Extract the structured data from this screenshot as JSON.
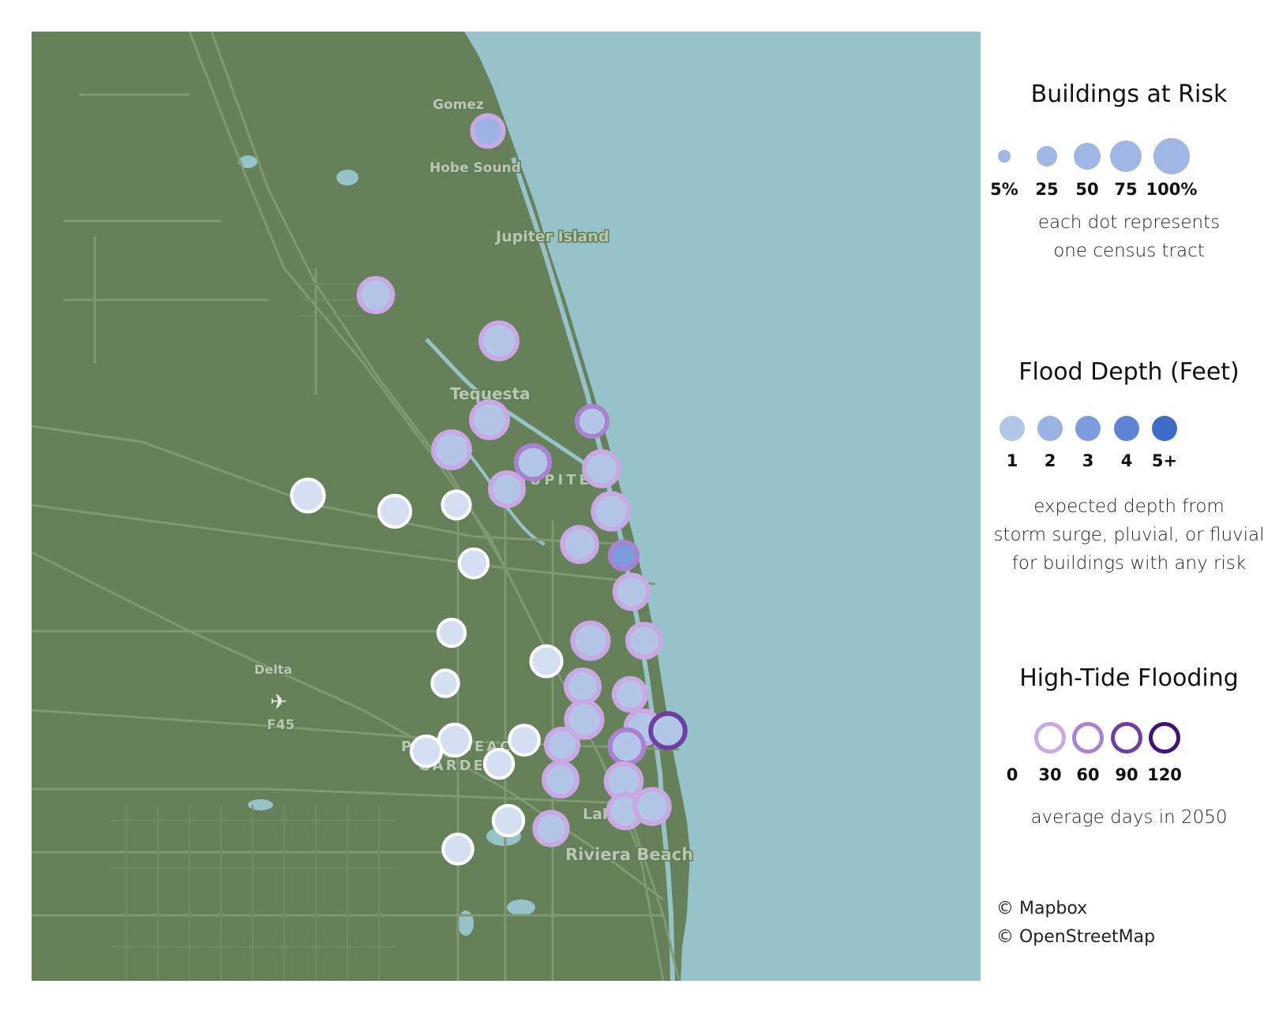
{
  "map": {
    "place_labels": [
      "Gomez",
      "Hobe Sound",
      "Jupiter Island",
      "Tequesta",
      "JUPITER",
      "Delta",
      "F45",
      "PALM BEACH",
      "GARDENS",
      "Lake Park",
      "Riviera Beach"
    ],
    "airport_icon": "airplane-icon",
    "colors": {
      "land": "#66805a",
      "water": "#96c3c9",
      "roads": "#7f9a73",
      "bubble_fill_1ft": "#b4c6e8",
      "bubble_fill_3ft": "#7b9ee0",
      "ring_none": "#ffffff",
      "ring_30": "#c9a8e4",
      "ring_60": "#a982d0",
      "ring_90": "#7b4ea8"
    },
    "tracts": [
      {
        "id": "t01",
        "risk_pct": 42,
        "depth_ft": 2,
        "tide_days": 30
      },
      {
        "id": "t02",
        "risk_pct": 52,
        "depth_ft": 1,
        "tide_days": 30
      },
      {
        "id": "t03",
        "risk_pct": 62,
        "depth_ft": 1,
        "tide_days": 30
      },
      {
        "id": "t04",
        "risk_pct": 62,
        "depth_ft": 1,
        "tide_days": 30
      },
      {
        "id": "t05",
        "risk_pct": 62,
        "depth_ft": 1,
        "tide_days": 30
      },
      {
        "id": "t06",
        "risk_pct": 40,
        "depth_ft": 1,
        "tide_days": 60
      },
      {
        "id": "t07",
        "risk_pct": 52,
        "depth_ft": 1,
        "tide_days": 60
      },
      {
        "id": "t08",
        "risk_pct": 55,
        "depth_ft": 1,
        "tide_days": 30
      },
      {
        "id": "t09",
        "risk_pct": 50,
        "depth_ft": 1,
        "tide_days": 30
      },
      {
        "id": "t10",
        "risk_pct": 60,
        "depth_ft": 1,
        "tide_days": 30
      },
      {
        "id": "t11",
        "risk_pct": 55,
        "depth_ft": 1,
        "tide_days": 30
      },
      {
        "id": "t12",
        "risk_pct": 30,
        "depth_ft": 3,
        "tide_days": 60
      },
      {
        "id": "t13",
        "risk_pct": 52,
        "depth_ft": 1,
        "tide_days": 30
      },
      {
        "id": "t14",
        "risk_pct": 60,
        "depth_ft": 1,
        "tide_days": 30
      },
      {
        "id": "t15",
        "risk_pct": 50,
        "depth_ft": 1,
        "tide_days": 30
      },
      {
        "id": "t16",
        "risk_pct": 50,
        "depth_ft": 1,
        "tide_days": 30
      },
      {
        "id": "t17",
        "risk_pct": 45,
        "depth_ft": 1,
        "tide_days": 30
      },
      {
        "id": "t18",
        "risk_pct": 60,
        "depth_ft": 1,
        "tide_days": 30
      },
      {
        "id": "t19",
        "risk_pct": 52,
        "depth_ft": 1,
        "tide_days": 30
      },
      {
        "id": "t20",
        "risk_pct": 52,
        "depth_ft": 1,
        "tide_days": 60
      },
      {
        "id": "t21",
        "risk_pct": 55,
        "depth_ft": 1,
        "tide_days": 90
      },
      {
        "id": "t22",
        "risk_pct": 45,
        "depth_ft": 1,
        "tide_days": 30
      },
      {
        "id": "t23",
        "risk_pct": 50,
        "depth_ft": 1,
        "tide_days": 30
      },
      {
        "id": "t24",
        "risk_pct": 58,
        "depth_ft": 1,
        "tide_days": 30
      },
      {
        "id": "t25",
        "risk_pct": 52,
        "depth_ft": 1,
        "tide_days": 30
      },
      {
        "id": "t26",
        "risk_pct": 55,
        "depth_ft": 1,
        "tide_days": 30
      },
      {
        "id": "t27",
        "risk_pct": 48,
        "depth_ft": 1,
        "tide_days": 30
      },
      {
        "id": "t28",
        "risk_pct": 48,
        "depth_ft": 1,
        "tide_days": 0
      },
      {
        "id": "t29",
        "risk_pct": 45,
        "depth_ft": 1,
        "tide_days": 0
      },
      {
        "id": "t30",
        "risk_pct": 32,
        "depth_ft": 1,
        "tide_days": 0
      },
      {
        "id": "t31",
        "risk_pct": 35,
        "depth_ft": 1,
        "tide_days": 0
      },
      {
        "id": "t32",
        "risk_pct": 30,
        "depth_ft": 1,
        "tide_days": 0
      },
      {
        "id": "t33",
        "risk_pct": 42,
        "depth_ft": 1,
        "tide_days": 0
      },
      {
        "id": "t34",
        "risk_pct": 28,
        "depth_ft": 1,
        "tide_days": 0
      },
      {
        "id": "t35",
        "risk_pct": 45,
        "depth_ft": 1,
        "tide_days": 0
      },
      {
        "id": "t36",
        "risk_pct": 40,
        "depth_ft": 1,
        "tide_days": 0
      },
      {
        "id": "t37",
        "risk_pct": 38,
        "depth_ft": 1,
        "tide_days": 0
      },
      {
        "id": "t38",
        "risk_pct": 35,
        "depth_ft": 1,
        "tide_days": 0
      },
      {
        "id": "t39",
        "risk_pct": 40,
        "depth_ft": 1,
        "tide_days": 0
      },
      {
        "id": "t40",
        "risk_pct": 38,
        "depth_ft": 1,
        "tide_days": 0
      }
    ]
  },
  "legend": {
    "risk": {
      "title": "Buildings at Risk",
      "ticks": [
        "5%",
        "25",
        "50",
        "75",
        "100%"
      ],
      "note_line1": "each dot represents",
      "note_line2": "one census tract",
      "color": "#a0b6e4"
    },
    "depth": {
      "title": "Flood Depth (Feet)",
      "ticks": [
        "1",
        "2",
        "3",
        "4",
        "5+"
      ],
      "colors": [
        "#b4c6e8",
        "#9ab2e4",
        "#7d9cdd",
        "#5d84d5",
        "#3e6cc6"
      ],
      "note_line1": "expected depth from",
      "note_line2": "storm surge, pluvial, or fluvial",
      "note_line3": "for buildings with any risk"
    },
    "tide": {
      "title": "High-Tide Flooding",
      "ticks": [
        "0",
        "30",
        "60",
        "90",
        "120"
      ],
      "colors": [
        "#ffffff",
        "#c9a8e4",
        "#a982d0",
        "#6e3fa0",
        "#3f1377"
      ],
      "note": "average days in 2050"
    },
    "attribution_line1": "© Mapbox",
    "attribution_line2": "© OpenStreetMap"
  }
}
